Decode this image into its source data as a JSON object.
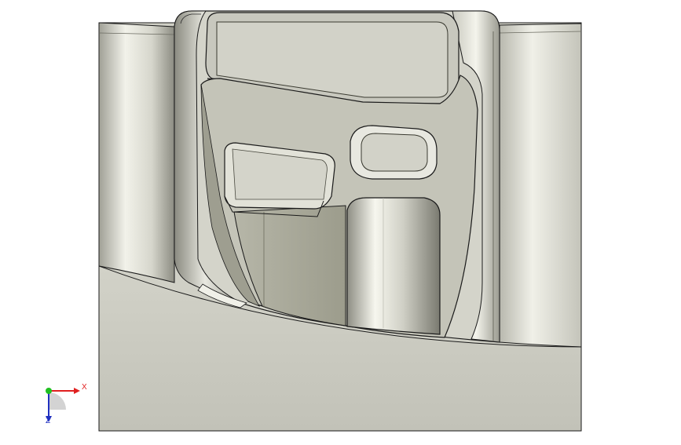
{
  "viewport": {
    "background": "#ffffff",
    "floor_color": "#c8c8be",
    "part_color": "#d8d8ce",
    "shadow_color": "#8a8a80",
    "edge_color": "#1a1a1a"
  },
  "triad": {
    "x_label": "X",
    "z_label": "Z",
    "x_color": "#e02020",
    "y_color": "#20c020",
    "z_color": "#2030c0"
  }
}
